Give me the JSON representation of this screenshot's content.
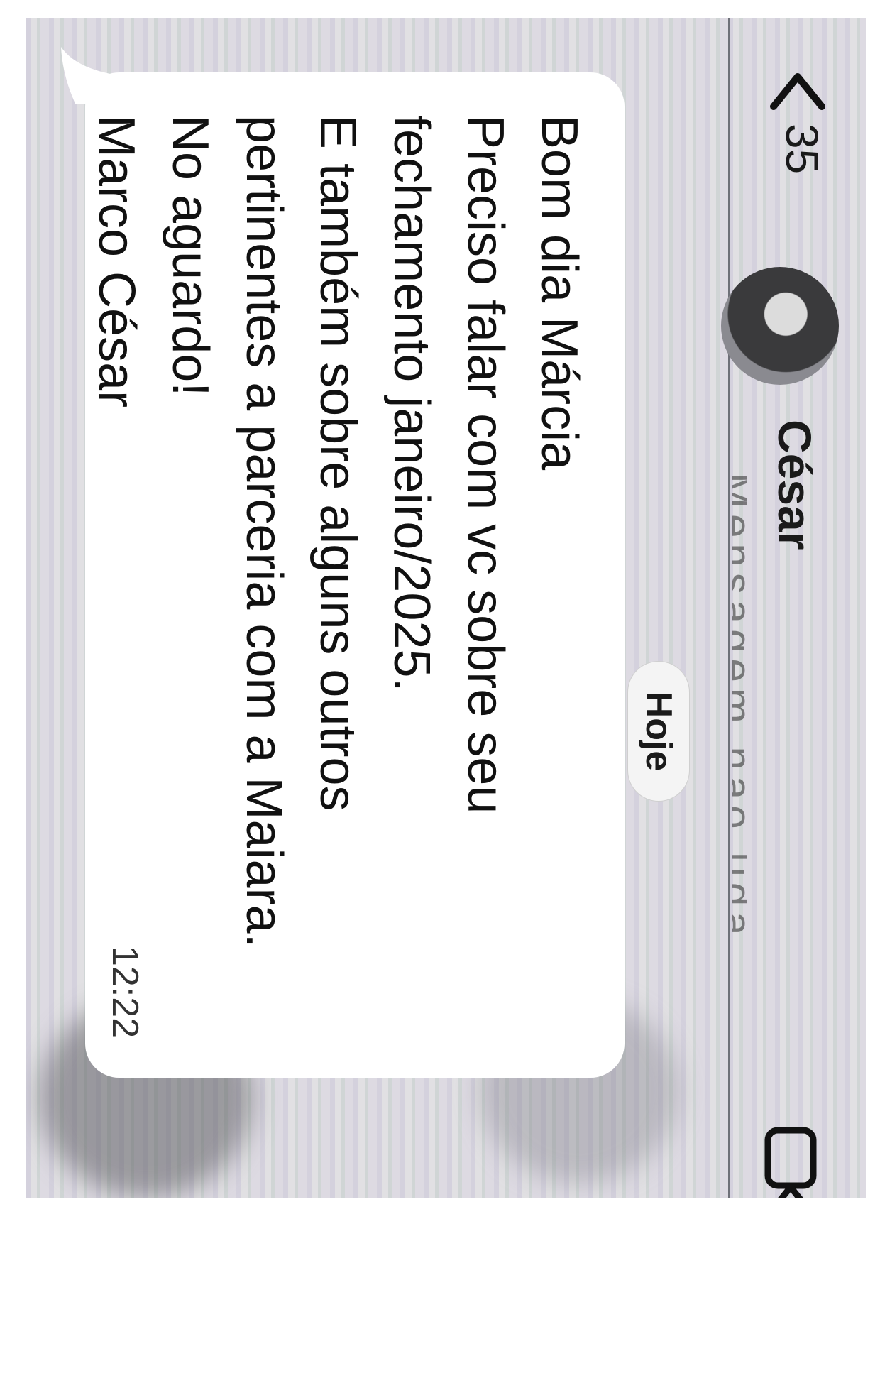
{
  "header": {
    "back_count": "35",
    "contact_name": "César",
    "subtitle": "Mensagem não lida"
  },
  "conversation": {
    "date_label": "Hoje",
    "messages": [
      {
        "lines": [
          "Bom dia Márcia",
          "Preciso falar com vc sobre seu",
          "fechamento janeiro/2025.",
          "E também sobre alguns outros",
          "pertinentes a parceria com a Maiara.",
          "No aguardo!",
          "Marco César"
        ],
        "time": "12:22"
      }
    ]
  },
  "icons": {
    "back": "chevron-left-icon",
    "video": "video-camera-icon"
  },
  "colors": {
    "bubble": "#ffffff",
    "text": "#111111"
  }
}
